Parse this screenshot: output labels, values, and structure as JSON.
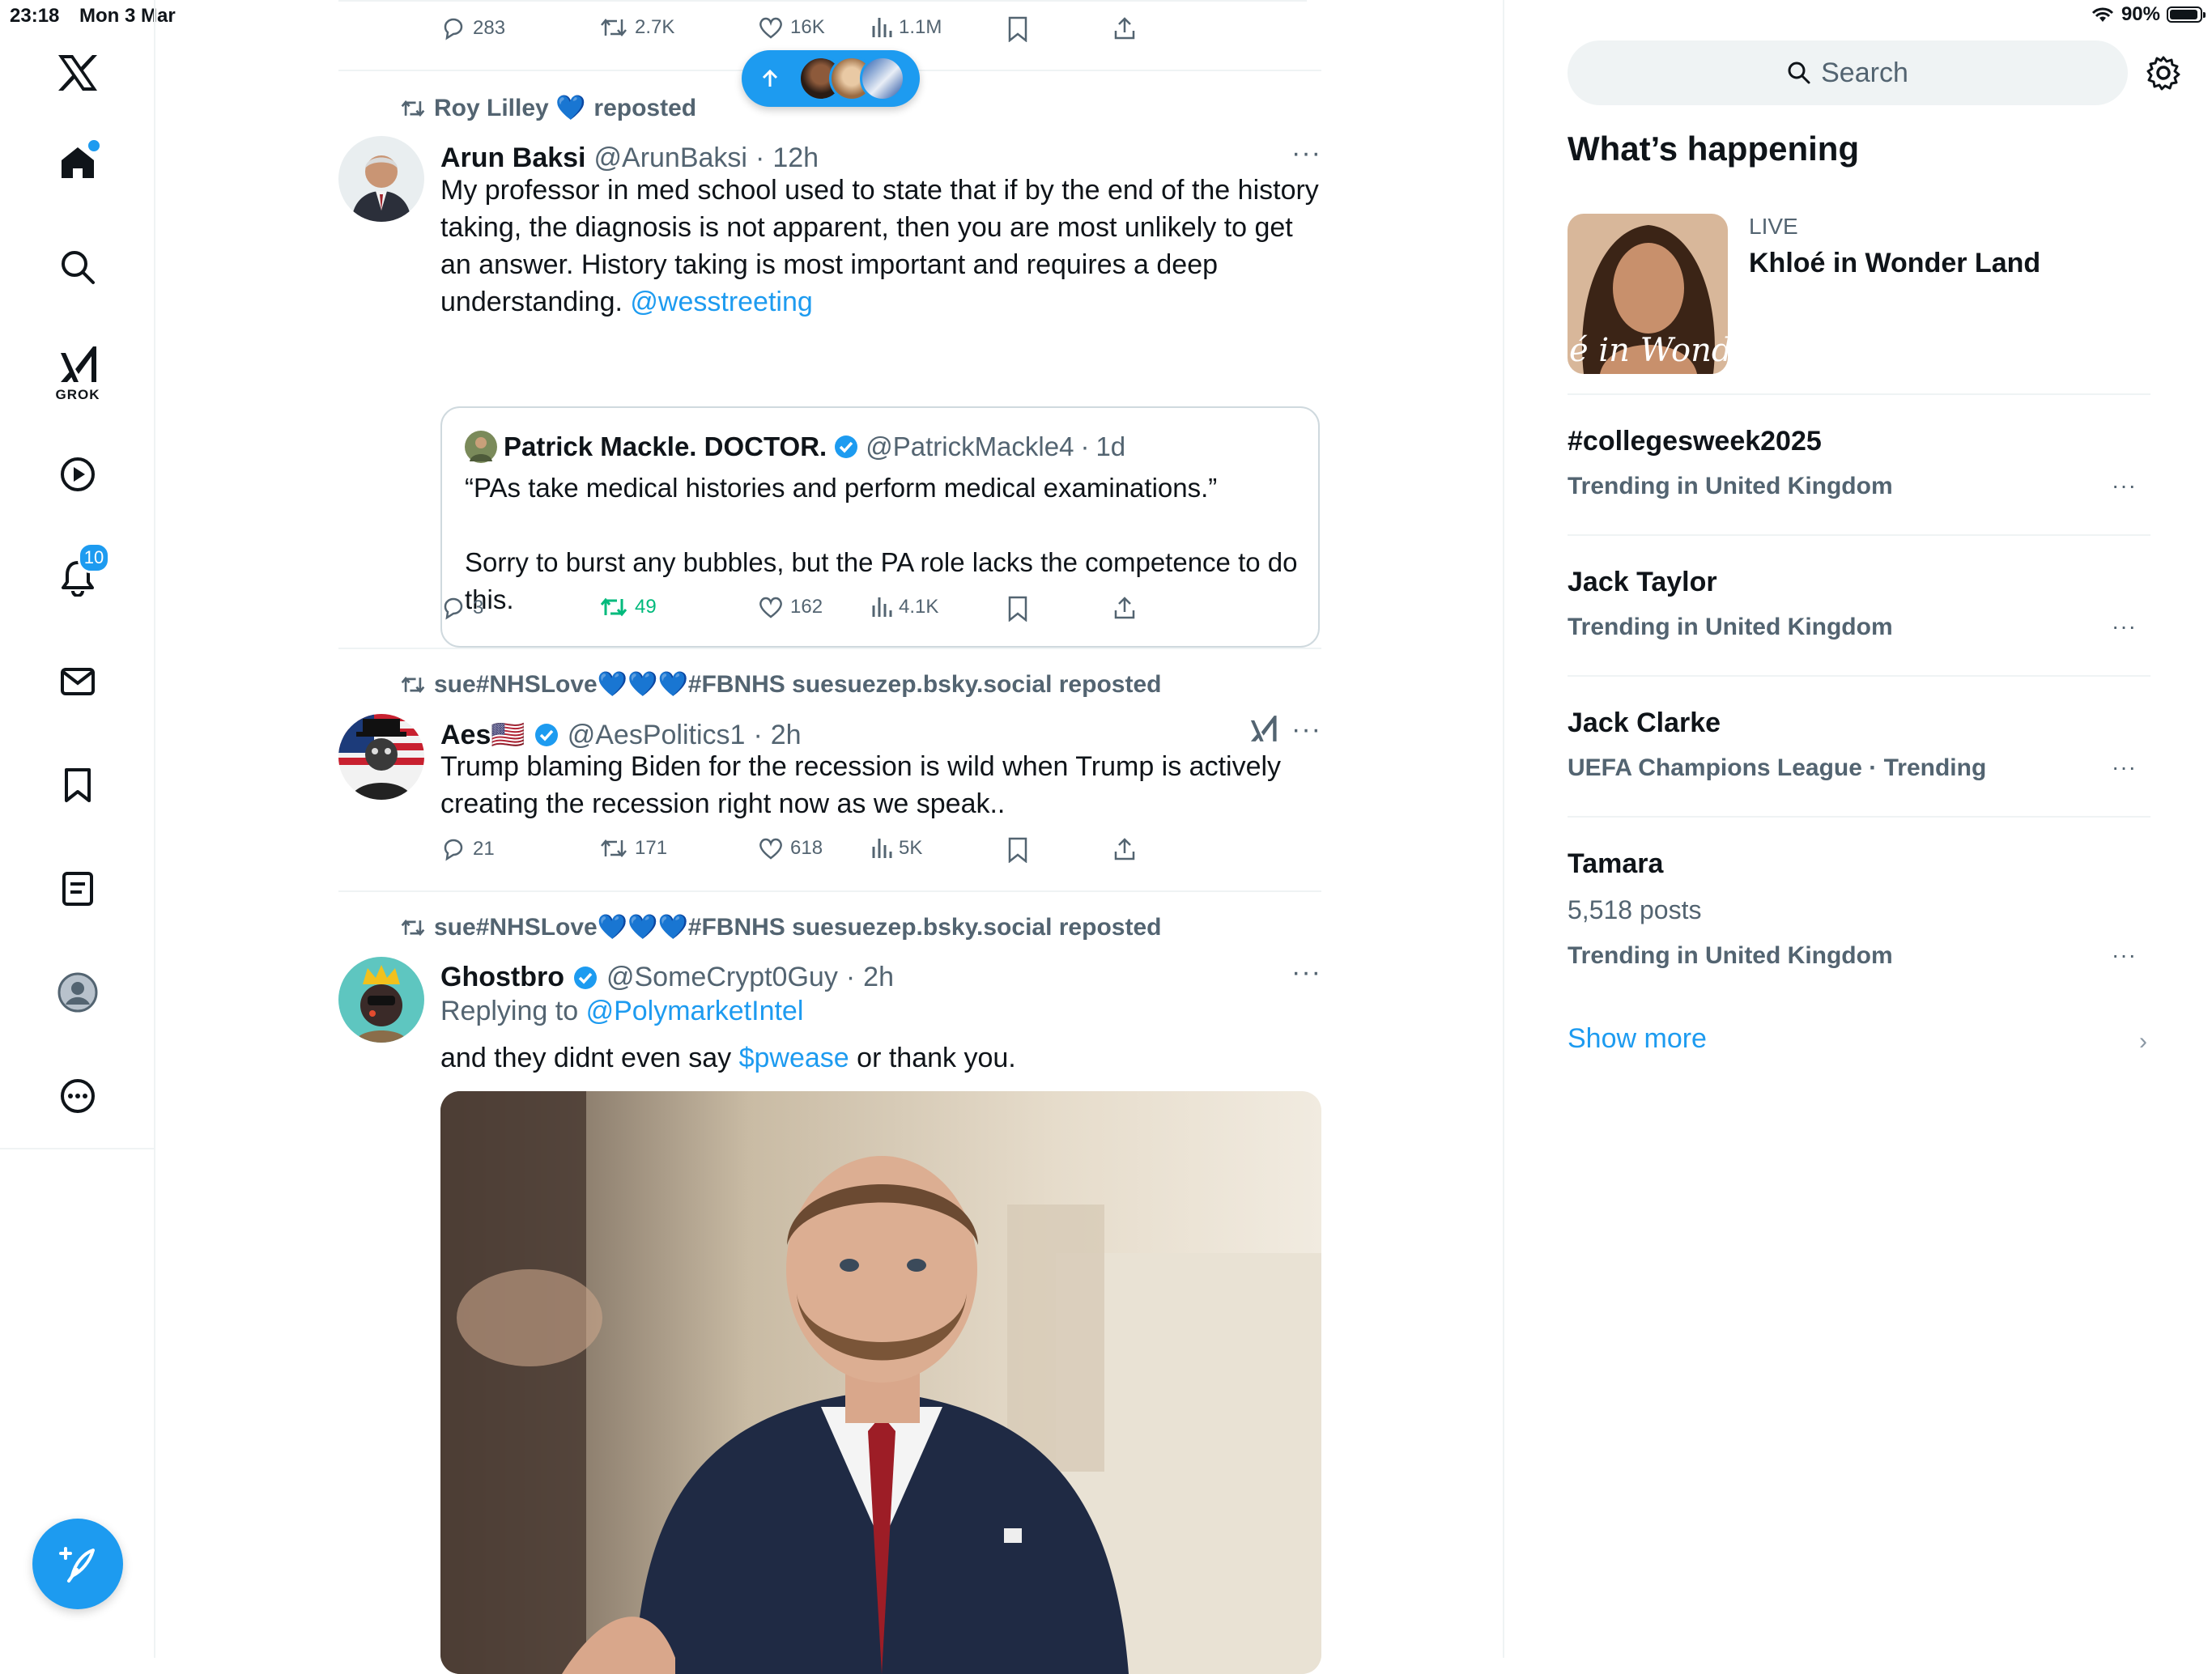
{
  "status_bar": {
    "time": "23:18",
    "date": "Mon 3 Mar",
    "battery": "90%"
  },
  "nav": {
    "grok_label": "GROK",
    "notifications_badge": "10"
  },
  "feed": {
    "top_actions": {
      "replies": "283",
      "reposts": "2.7K",
      "likes": "16K",
      "views": "1.1M"
    },
    "tweets": [
      {
        "repost_by": "Roy Lilley 💙",
        "repost_suffix": "reposted",
        "name": "Arun Baksi",
        "handle": "@ArunBaksi",
        "time": "12h",
        "text": "My professor in med school used to state that if by the end of the history taking, the diagnosis is not apparent, then you are most unlikely to get an answer. History taking is most important and requires a deep understanding.",
        "mention": "@wesstreeting",
        "quote": {
          "name": "Patrick Mackle. DOCTOR.",
          "handle": "@PatrickMackle4",
          "time": "1d",
          "line1": "“PAs take medical histories and perform medical examinations.”",
          "line2": "Sorry to burst any bubbles, but the PA role lacks the competence to do this."
        },
        "actions": {
          "replies": "3",
          "reposts": "49",
          "likes": "162",
          "views": "4.1K"
        }
      },
      {
        "repost_by": "sue#NHSLove💙💙💙#FBNHS suesuezep.bsky.social reposted",
        "name": "Aes🇺🇸",
        "handle": "@AesPolitics1",
        "time": "2h",
        "text": "Trump blaming Biden for the recession is wild when Trump is actively creating the recession right now as we speak..",
        "actions": {
          "replies": "21",
          "reposts": "171",
          "likes": "618",
          "views": "5K"
        }
      },
      {
        "repost_by": "sue#NHSLove💙💙💙#FBNHS suesuezep.bsky.social reposted",
        "name": "Ghostbro",
        "handle": "@SomeCrypt0Guy",
        "time": "2h",
        "replying_prefix": "Replying to",
        "replying_to": "@PolymarketIntel",
        "text_before": "and they didnt even say",
        "cashtag": "$pwease",
        "text_after": "or thank you."
      }
    ]
  },
  "sidebar": {
    "search_placeholder": "Search",
    "whats_happening": "What’s happening",
    "live": {
      "tag": "LIVE",
      "title": "Khloé in Wonder Land",
      "image_text": "é in Wonder L"
    },
    "trends": [
      {
        "title": "#collegesweek2025",
        "sub": "Trending in United Kingdom"
      },
      {
        "title": "Jack Taylor",
        "sub": "Trending in United Kingdom"
      },
      {
        "title": "Jack Clarke",
        "sub": "UEFA Champions League · Trending"
      },
      {
        "title": "Tamara",
        "posts": "5,518 posts",
        "sub": "Trending in United Kingdom"
      }
    ],
    "show_more": "Show more"
  },
  "colors": {
    "accent": "#1d9bf0",
    "repost_green": "#00ba7c",
    "muted": "#536471"
  }
}
